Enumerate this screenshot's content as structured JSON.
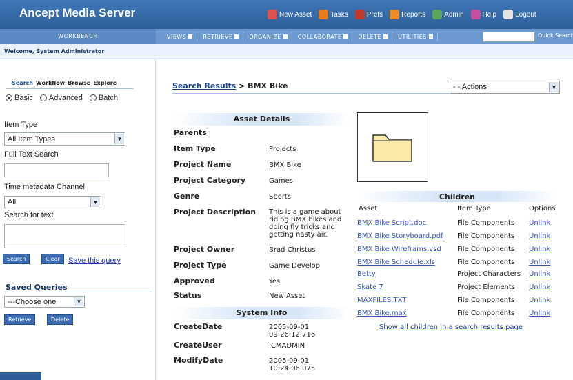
{
  "app": {
    "title": "Ancept Media Server"
  },
  "top_links": [
    {
      "label": "New Asset",
      "icon": "new-asset-icon",
      "color": "#d9534f"
    },
    {
      "label": "Tasks",
      "icon": "tasks-icon",
      "color": "#e87d1e"
    },
    {
      "label": "Prefs",
      "icon": "prefs-icon",
      "color": "#c0392b"
    },
    {
      "label": "Reports",
      "icon": "reports-icon",
      "color": "#e88d2a"
    },
    {
      "label": "Admin",
      "icon": "admin-icon",
      "color": "#5ca35c"
    },
    {
      "label": "Help",
      "icon": "help-icon",
      "color": "#c44fa0"
    },
    {
      "label": "Logout",
      "icon": "logout-icon",
      "color": "#e2e2e2"
    }
  ],
  "nav": {
    "workbench": "WORKBENCH",
    "menus": [
      "VIEWS",
      "RETRIEVE",
      "ORGANIZE",
      "COLLABORATE",
      "DELETE",
      "UTILITIES"
    ],
    "quick_search": "Quick Search"
  },
  "welcome": "Welcome, System Administrator",
  "left": {
    "tabs": [
      "Search",
      "Workflow",
      "Browse",
      "Explore"
    ],
    "radios": [
      {
        "label": "Basic",
        "checked": true
      },
      {
        "label": "Advanced",
        "checked": false
      },
      {
        "label": "Batch",
        "checked": false
      }
    ],
    "item_type_label": "Item Type",
    "item_type_value": "All Item Types",
    "full_text_label": "Full Text Search",
    "time_channel_label": "Time metadata Channel",
    "time_channel_value": "All",
    "search_text_label": "Search for text",
    "search_button": "Search",
    "clear_button": "Clear",
    "save_query": "Save this query",
    "saved_queries_title": "Saved Queries",
    "saved_select": "---Choose one",
    "retrieve_button": "Retrieve",
    "delete_button": "Delete"
  },
  "main": {
    "crumb_link": "Search Results",
    "crumb_current": "> BMX Bike",
    "actions": "- - Actions",
    "asset_details_title": "Asset Details",
    "details": [
      {
        "key": "Parents",
        "value": ""
      },
      {
        "key": "Item Type",
        "value": "Projects"
      },
      {
        "key": "Project Name",
        "value": "BMX Bike"
      },
      {
        "key": "Project Category",
        "value": "Games"
      },
      {
        "key": "Genre",
        "value": "Sports"
      },
      {
        "key": "Project Description",
        "value": "This is a game about riding BMX bikes and doing fly tricks and getting nasty air."
      },
      {
        "key": "Project Owner",
        "value": "Brad Christus"
      },
      {
        "key": "Project Type",
        "value": "Game Develop"
      },
      {
        "key": "Approved",
        "value": "Yes"
      },
      {
        "key": "Status",
        "value": "New Asset"
      }
    ],
    "system_info_title": "System Info",
    "system_info": [
      {
        "key": "CreateDate",
        "value": "2005-09-01 09:26:12.716"
      },
      {
        "key": "CreateUser",
        "value": "ICMADMIN"
      },
      {
        "key": "ModifyDate",
        "value": "2005-09-01 10:24:06.075"
      }
    ],
    "children_title": "Children",
    "children_cols": [
      "Asset",
      "Item Type",
      "Options"
    ],
    "children": [
      {
        "asset": "BMX Bike Script.doc",
        "type": "File Components",
        "option": "Unlink"
      },
      {
        "asset": "BMX Bike Storyboard.pdf",
        "type": "File Components",
        "option": "Unlink"
      },
      {
        "asset": "BMX Bike Wireframs.vsd",
        "type": "File Components",
        "option": "Unlink"
      },
      {
        "asset": "BMX Bike Schedule.xls",
        "type": "File Components",
        "option": "Unlink"
      },
      {
        "asset": "Betty",
        "type": "Project Characters",
        "option": "Unlink"
      },
      {
        "asset": "Skate 7",
        "type": "Project Elements",
        "option": "Unlink"
      },
      {
        "asset": "MAXFILES.TXT",
        "type": "File Components",
        "option": "Unlink"
      },
      {
        "asset": "BMX Bike.max",
        "type": "File Components",
        "option": "Unlink"
      }
    ],
    "show_all": "Show all children in a search results page"
  }
}
